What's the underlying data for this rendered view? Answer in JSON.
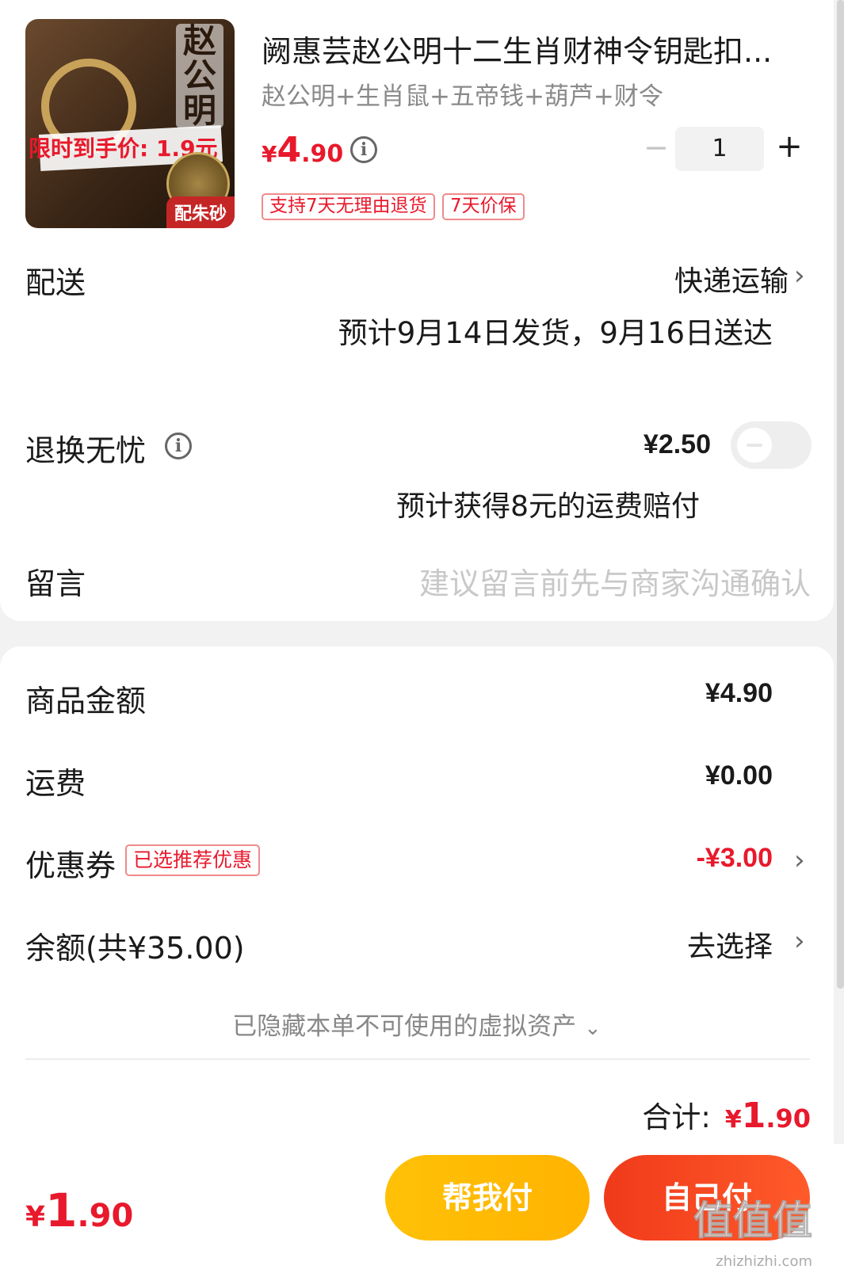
{
  "product": {
    "image_promo": "限时到手价: 1.9元",
    "image_calligraphy": "赵公明",
    "image_tag": "配朱砂",
    "title": "阙惠芸赵公明十二生肖财神令钥匙扣...",
    "spec": "赵公明+生肖鼠+五帝钱+葫芦+财令",
    "price_currency": "¥",
    "price_int": "4",
    "price_dec": ".90",
    "quantity": "1",
    "minus_label": "−",
    "plus_label": "+",
    "badges": [
      "支持7天无理由退货",
      "7天价保"
    ]
  },
  "delivery": {
    "label": "配送",
    "method": "快递运输",
    "estimate": "预计9月14日发货，9月16日送达"
  },
  "return_insurance": {
    "label": "退换无忧",
    "price": "¥2.50",
    "note": "预计获得8元的运费赔付",
    "enabled": false
  },
  "memo": {
    "label": "留言",
    "placeholder": "建议留言前先与商家沟通确认"
  },
  "summary": {
    "goods_label": "商品金额",
    "goods_value": "¥4.90",
    "shipping_label": "运费",
    "shipping_value": "¥0.00",
    "coupon_label": "优惠券",
    "coupon_badge": "已选推荐优惠",
    "coupon_value": "-¥3.00",
    "balance_label": "余额(共¥35.00)",
    "balance_action": "去选择",
    "hidden_assets": "已隐藏本单不可使用的虚拟资产",
    "total_label": "合计:",
    "total_currency": "¥",
    "total_int": "1",
    "total_dec": ".90"
  },
  "bottom_bar": {
    "price_currency": "¥",
    "price_int": "1",
    "price_dec": ".90",
    "help_pay_label": "帮我付",
    "self_pay_label": "自己付"
  },
  "watermark": {
    "text": "值值值",
    "domain": "zhizhizhi.com"
  },
  "colors": {
    "accent_red": "#e8192c",
    "help_pay_yellow": "#ffb300",
    "self_pay_orange": "#f03a1a"
  },
  "icons": [
    "info-icon",
    "chevron-right-icon",
    "chevron-down-icon"
  ]
}
